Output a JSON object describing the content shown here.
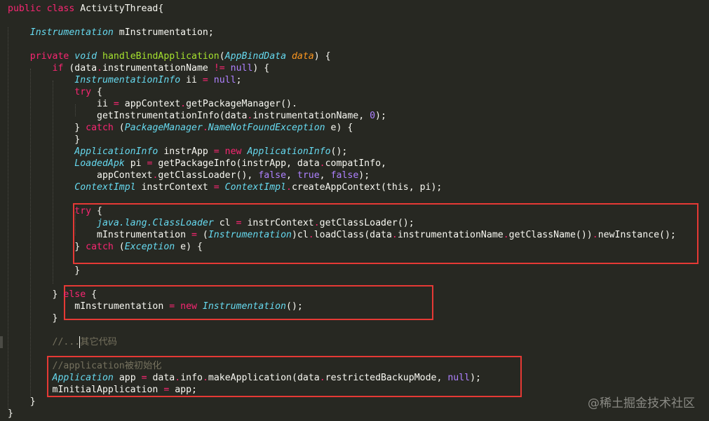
{
  "lines": [
    [
      [
        "public class ",
        "kw"
      ],
      [
        "ActivityThread{",
        ""
      ]
    ],
    [],
    [
      [
        "    ",
        ""
      ],
      [
        "Instrumentation",
        "typ"
      ],
      [
        " mInstrumentation;",
        ""
      ]
    ],
    [],
    [
      [
        "    ",
        ""
      ],
      [
        "private ",
        "kw"
      ],
      [
        "void ",
        "typ"
      ],
      [
        "handleBindApplication",
        "fn"
      ],
      [
        "(",
        ""
      ],
      [
        "AppBindData ",
        "typ"
      ],
      [
        "data",
        "prm"
      ],
      [
        ") {",
        ""
      ]
    ],
    [
      [
        "        ",
        ""
      ],
      [
        "if ",
        "kw"
      ],
      [
        "(data",
        ""
      ],
      [
        ".",
        "kw"
      ],
      [
        "instrumentationName ",
        ""
      ],
      [
        "!= ",
        "kw"
      ],
      [
        "null",
        "lit"
      ],
      [
        ") {",
        ""
      ]
    ],
    [
      [
        "            ",
        ""
      ],
      [
        "InstrumentationInfo",
        "typ"
      ],
      [
        " ii ",
        ""
      ],
      [
        "= ",
        "kw"
      ],
      [
        "null",
        "lit"
      ],
      [
        ";",
        ""
      ]
    ],
    [
      [
        "            ",
        ""
      ],
      [
        "try ",
        "kw"
      ],
      [
        "{",
        ""
      ]
    ],
    [
      [
        "                ii ",
        ""
      ],
      [
        "= ",
        "kw"
      ],
      [
        "appContext",
        ""
      ],
      [
        ".",
        "kw"
      ],
      [
        "getPackageManager().",
        ""
      ]
    ],
    [
      [
        "                getInstrumentationInfo(data",
        ""
      ],
      [
        ".",
        "kw"
      ],
      [
        "instrumentationName, ",
        ""
      ],
      [
        "0",
        "lit"
      ],
      [
        ");",
        ""
      ]
    ],
    [
      [
        "            } ",
        ""
      ],
      [
        "catch ",
        "kw"
      ],
      [
        "(",
        ""
      ],
      [
        "PackageManager",
        "typ"
      ],
      [
        ".",
        "kw"
      ],
      [
        "NameNotFoundException",
        "typ"
      ],
      [
        " e) {",
        ""
      ]
    ],
    [
      [
        "            }",
        ""
      ]
    ],
    [
      [
        "            ",
        ""
      ],
      [
        "ApplicationInfo",
        "typ"
      ],
      [
        " instrApp ",
        ""
      ],
      [
        "= ",
        "kw"
      ],
      [
        "new ",
        "kw"
      ],
      [
        "ApplicationInfo",
        "typ"
      ],
      [
        "();",
        ""
      ]
    ],
    [
      [
        "            ",
        ""
      ],
      [
        "LoadedApk",
        "typ"
      ],
      [
        " pi ",
        ""
      ],
      [
        "= ",
        "kw"
      ],
      [
        "getPackageInfo(instrApp, data",
        ""
      ],
      [
        ".",
        "kw"
      ],
      [
        "compatInfo,",
        ""
      ]
    ],
    [
      [
        "                appContext",
        ""
      ],
      [
        ".",
        "kw"
      ],
      [
        "getClassLoader(), ",
        ""
      ],
      [
        "false",
        "lit"
      ],
      [
        ", ",
        ""
      ],
      [
        "true",
        "lit"
      ],
      [
        ", ",
        ""
      ],
      [
        "false",
        "lit"
      ],
      [
        ");",
        ""
      ]
    ],
    [
      [
        "            ",
        ""
      ],
      [
        "ContextImpl",
        "typ"
      ],
      [
        " instrContext ",
        ""
      ],
      [
        "= ",
        "kw"
      ],
      [
        "ContextImpl",
        "typ"
      ],
      [
        ".",
        "kw"
      ],
      [
        "createAppContext(this, pi);",
        ""
      ]
    ],
    [],
    [
      [
        "            ",
        ""
      ],
      [
        "try ",
        "kw"
      ],
      [
        "{",
        ""
      ]
    ],
    [
      [
        "                ",
        ""
      ],
      [
        "java.lang.ClassLoader",
        "typ"
      ],
      [
        " cl ",
        ""
      ],
      [
        "= ",
        "kw"
      ],
      [
        "instrContext",
        ""
      ],
      [
        ".",
        "kw"
      ],
      [
        "getClassLoader();",
        ""
      ]
    ],
    [
      [
        "                mInstrumentation ",
        ""
      ],
      [
        "= ",
        "kw"
      ],
      [
        "(",
        ""
      ],
      [
        "Instrumentation",
        "typ"
      ],
      [
        ")cl",
        ""
      ],
      [
        ".",
        "kw"
      ],
      [
        "loadClass(data",
        ""
      ],
      [
        ".",
        "kw"
      ],
      [
        "instrumentationName",
        ""
      ],
      [
        ".",
        "kw"
      ],
      [
        "getClassName())",
        ""
      ],
      [
        ".",
        "kw"
      ],
      [
        "newInstance();",
        ""
      ]
    ],
    [
      [
        "            } ",
        ""
      ],
      [
        "catch ",
        "kw"
      ],
      [
        "(",
        ""
      ],
      [
        "Exception",
        "typ"
      ],
      [
        " e) {",
        ""
      ]
    ],
    [],
    [
      [
        "            }",
        ""
      ]
    ],
    [],
    [
      [
        "        } ",
        ""
      ],
      [
        "else ",
        "kw"
      ],
      [
        "{",
        ""
      ]
    ],
    [
      [
        "            mInstrumentation ",
        ""
      ],
      [
        "= ",
        "kw"
      ],
      [
        "new ",
        "kw"
      ],
      [
        "Instrumentation",
        "typ"
      ],
      [
        "();",
        ""
      ]
    ],
    [
      [
        "        }",
        ""
      ]
    ],
    [],
    [
      [
        "        ",
        ""
      ],
      [
        "//...其它代码",
        "cm"
      ]
    ],
    [],
    [
      [
        "        ",
        ""
      ],
      [
        "//application被初始化",
        "cm"
      ]
    ],
    [
      [
        "        ",
        ""
      ],
      [
        "Application",
        "typ"
      ],
      [
        " app ",
        ""
      ],
      [
        "= ",
        "kw"
      ],
      [
        "data",
        ""
      ],
      [
        ".",
        "kw"
      ],
      [
        "info",
        ""
      ],
      [
        ".",
        "kw"
      ],
      [
        "makeApplication(data",
        ""
      ],
      [
        ".",
        "kw"
      ],
      [
        "restrictedBackupMode, ",
        ""
      ],
      [
        "null",
        "lit"
      ],
      [
        ");",
        ""
      ]
    ],
    [
      [
        "        mInitialApplication ",
        ""
      ],
      [
        "= ",
        "kw"
      ],
      [
        "app;",
        ""
      ]
    ],
    [
      [
        "    }",
        ""
      ]
    ],
    [
      [
        "}",
        ""
      ]
    ]
  ],
  "watermark": "@稀土掘金技术社区",
  "colors": {
    "background": "#272822",
    "text": "#f8f8f2",
    "keyword": "#f92672",
    "type": "#66d9ef",
    "function": "#a6e22e",
    "literal": "#ae81ff",
    "comment": "#75715e",
    "parameter": "#fd971f",
    "highlight_box": "#e53935"
  }
}
